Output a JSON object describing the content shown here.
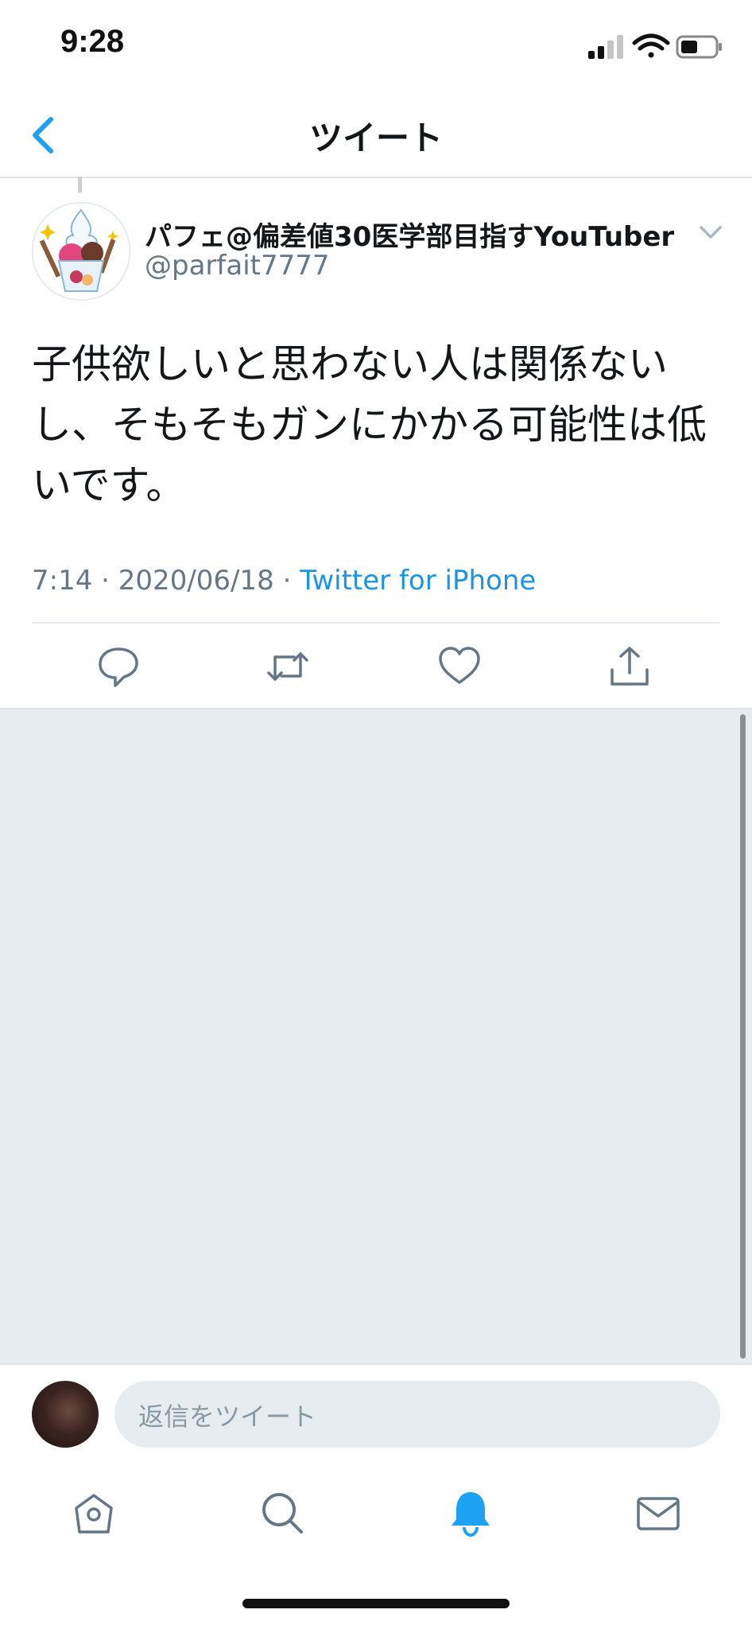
{
  "status_bar": {
    "time": "9:28"
  },
  "nav": {
    "title": "ツイート"
  },
  "tweet": {
    "display_name": "パフェ@偏差値30医学部目指すYouTuber",
    "handle": "@parfait7777",
    "text": "子供欲しいと思わない人は関係ないし、そもそもガンにかかる可能性は低いです。",
    "time": "7:14",
    "date": "2020/06/18",
    "separator": " · ",
    "source": "Twitter for iPhone"
  },
  "actions": [
    "reply-icon",
    "retweet-icon",
    "like-icon",
    "share-icon"
  ],
  "reply_bar": {
    "placeholder": "返信をツイート"
  },
  "tabs": [
    "home-icon",
    "search-icon",
    "notifications-icon",
    "messages-icon"
  ],
  "colors": {
    "accent": "#1da1f2",
    "muted": "#657786",
    "background_grey": "#e6ecf0"
  }
}
